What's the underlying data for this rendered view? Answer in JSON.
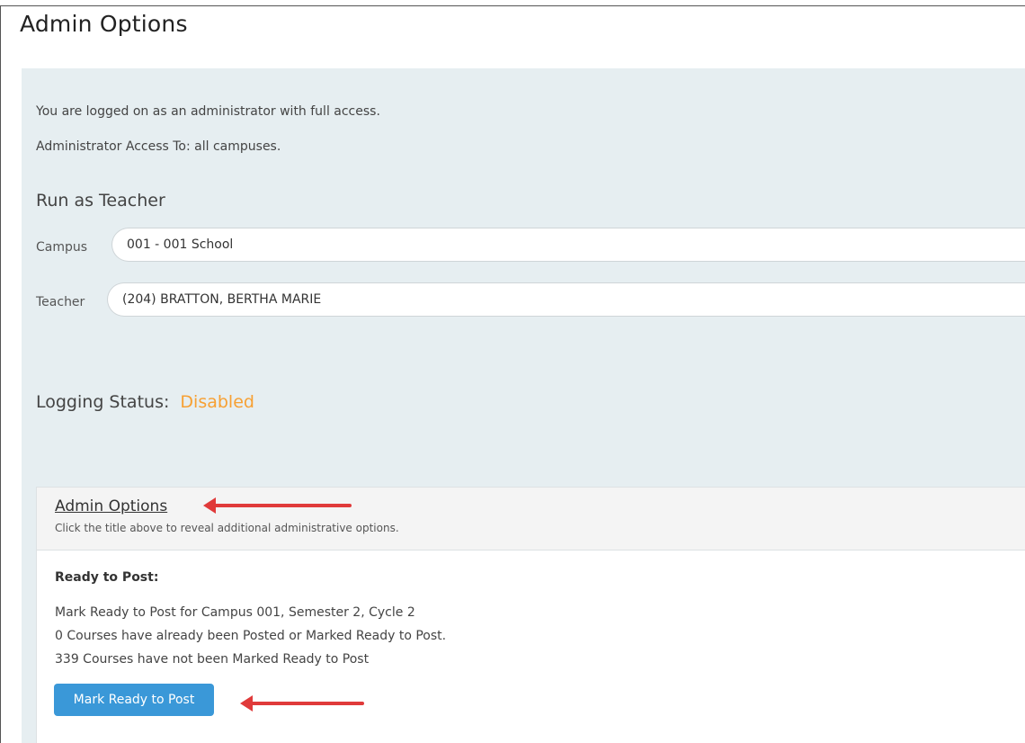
{
  "page": {
    "title": "Admin Options"
  },
  "info": {
    "logged_on": "You are logged on as an administrator with full access.",
    "access_to": "Administrator Access To: all campuses."
  },
  "run_as_teacher": {
    "heading": "Run as Teacher",
    "campus_label": "Campus",
    "campus_value": "001 - 001 School",
    "teacher_label": "Teacher",
    "teacher_value": "(204) BRATTON, BERTHA MARIE"
  },
  "logging": {
    "label": "Logging Status:",
    "value": "Disabled",
    "value_color": "#f7a033"
  },
  "admin_box": {
    "link_label": "Admin Options",
    "hint": "Click the title above to reveal additional administrative options.",
    "ready_title": "Ready to Post:",
    "lines": [
      "Mark Ready to Post for Campus 001, Semester 2, Cycle 2",
      "0 Courses have already been Posted or Marked Ready to Post.",
      "339 Courses have not been Marked Ready to Post"
    ],
    "button_label": "Mark Ready to Post"
  },
  "colors": {
    "panel_bg": "#e6eef1",
    "button_bg": "#3a98d8",
    "arrow": "#e03a3a"
  }
}
